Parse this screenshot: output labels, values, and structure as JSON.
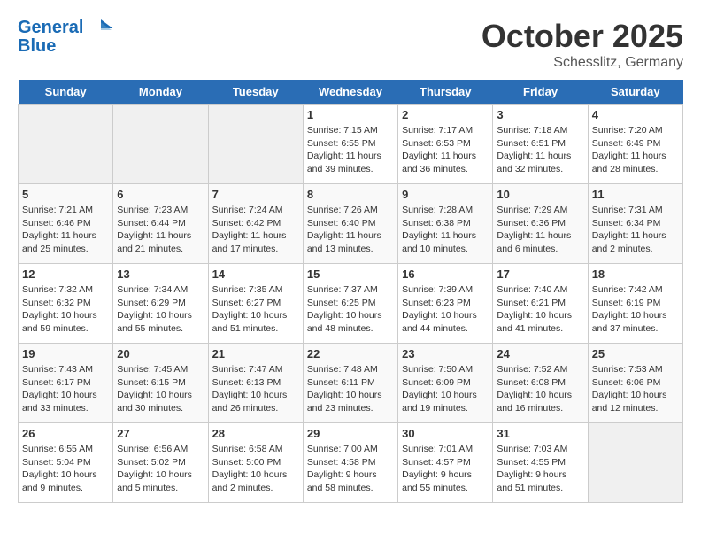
{
  "header": {
    "logo_line1": "General",
    "logo_line2": "Blue",
    "month": "October 2025",
    "location": "Schesslitz, Germany"
  },
  "days_of_week": [
    "Sunday",
    "Monday",
    "Tuesday",
    "Wednesday",
    "Thursday",
    "Friday",
    "Saturday"
  ],
  "weeks": [
    [
      {
        "day": "",
        "info": ""
      },
      {
        "day": "",
        "info": ""
      },
      {
        "day": "",
        "info": ""
      },
      {
        "day": "1",
        "info": "Sunrise: 7:15 AM\nSunset: 6:55 PM\nDaylight: 11 hours\nand 39 minutes."
      },
      {
        "day": "2",
        "info": "Sunrise: 7:17 AM\nSunset: 6:53 PM\nDaylight: 11 hours\nand 36 minutes."
      },
      {
        "day": "3",
        "info": "Sunrise: 7:18 AM\nSunset: 6:51 PM\nDaylight: 11 hours\nand 32 minutes."
      },
      {
        "day": "4",
        "info": "Sunrise: 7:20 AM\nSunset: 6:49 PM\nDaylight: 11 hours\nand 28 minutes."
      }
    ],
    [
      {
        "day": "5",
        "info": "Sunrise: 7:21 AM\nSunset: 6:46 PM\nDaylight: 11 hours\nand 25 minutes."
      },
      {
        "day": "6",
        "info": "Sunrise: 7:23 AM\nSunset: 6:44 PM\nDaylight: 11 hours\nand 21 minutes."
      },
      {
        "day": "7",
        "info": "Sunrise: 7:24 AM\nSunset: 6:42 PM\nDaylight: 11 hours\nand 17 minutes."
      },
      {
        "day": "8",
        "info": "Sunrise: 7:26 AM\nSunset: 6:40 PM\nDaylight: 11 hours\nand 13 minutes."
      },
      {
        "day": "9",
        "info": "Sunrise: 7:28 AM\nSunset: 6:38 PM\nDaylight: 11 hours\nand 10 minutes."
      },
      {
        "day": "10",
        "info": "Sunrise: 7:29 AM\nSunset: 6:36 PM\nDaylight: 11 hours\nand 6 minutes."
      },
      {
        "day": "11",
        "info": "Sunrise: 7:31 AM\nSunset: 6:34 PM\nDaylight: 11 hours\nand 2 minutes."
      }
    ],
    [
      {
        "day": "12",
        "info": "Sunrise: 7:32 AM\nSunset: 6:32 PM\nDaylight: 10 hours\nand 59 minutes."
      },
      {
        "day": "13",
        "info": "Sunrise: 7:34 AM\nSunset: 6:29 PM\nDaylight: 10 hours\nand 55 minutes."
      },
      {
        "day": "14",
        "info": "Sunrise: 7:35 AM\nSunset: 6:27 PM\nDaylight: 10 hours\nand 51 minutes."
      },
      {
        "day": "15",
        "info": "Sunrise: 7:37 AM\nSunset: 6:25 PM\nDaylight: 10 hours\nand 48 minutes."
      },
      {
        "day": "16",
        "info": "Sunrise: 7:39 AM\nSunset: 6:23 PM\nDaylight: 10 hours\nand 44 minutes."
      },
      {
        "day": "17",
        "info": "Sunrise: 7:40 AM\nSunset: 6:21 PM\nDaylight: 10 hours\nand 41 minutes."
      },
      {
        "day": "18",
        "info": "Sunrise: 7:42 AM\nSunset: 6:19 PM\nDaylight: 10 hours\nand 37 minutes."
      }
    ],
    [
      {
        "day": "19",
        "info": "Sunrise: 7:43 AM\nSunset: 6:17 PM\nDaylight: 10 hours\nand 33 minutes."
      },
      {
        "day": "20",
        "info": "Sunrise: 7:45 AM\nSunset: 6:15 PM\nDaylight: 10 hours\nand 30 minutes."
      },
      {
        "day": "21",
        "info": "Sunrise: 7:47 AM\nSunset: 6:13 PM\nDaylight: 10 hours\nand 26 minutes."
      },
      {
        "day": "22",
        "info": "Sunrise: 7:48 AM\nSunset: 6:11 PM\nDaylight: 10 hours\nand 23 minutes."
      },
      {
        "day": "23",
        "info": "Sunrise: 7:50 AM\nSunset: 6:09 PM\nDaylight: 10 hours\nand 19 minutes."
      },
      {
        "day": "24",
        "info": "Sunrise: 7:52 AM\nSunset: 6:08 PM\nDaylight: 10 hours\nand 16 minutes."
      },
      {
        "day": "25",
        "info": "Sunrise: 7:53 AM\nSunset: 6:06 PM\nDaylight: 10 hours\nand 12 minutes."
      }
    ],
    [
      {
        "day": "26",
        "info": "Sunrise: 6:55 AM\nSunset: 5:04 PM\nDaylight: 10 hours\nand 9 minutes."
      },
      {
        "day": "27",
        "info": "Sunrise: 6:56 AM\nSunset: 5:02 PM\nDaylight: 10 hours\nand 5 minutes."
      },
      {
        "day": "28",
        "info": "Sunrise: 6:58 AM\nSunset: 5:00 PM\nDaylight: 10 hours\nand 2 minutes."
      },
      {
        "day": "29",
        "info": "Sunrise: 7:00 AM\nSunset: 4:58 PM\nDaylight: 9 hours\nand 58 minutes."
      },
      {
        "day": "30",
        "info": "Sunrise: 7:01 AM\nSunset: 4:57 PM\nDaylight: 9 hours\nand 55 minutes."
      },
      {
        "day": "31",
        "info": "Sunrise: 7:03 AM\nSunset: 4:55 PM\nDaylight: 9 hours\nand 51 minutes."
      },
      {
        "day": "",
        "info": ""
      }
    ]
  ]
}
